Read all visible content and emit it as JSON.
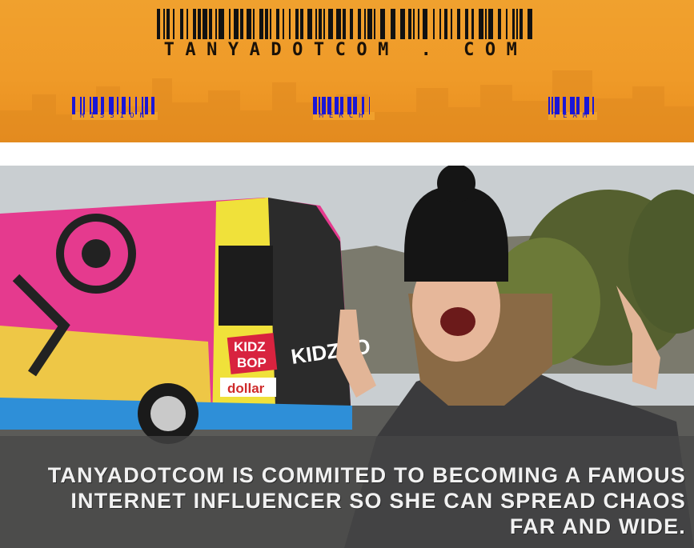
{
  "header": {
    "logo_text": "TANYADOTCOM.COM",
    "logo_display": "TANYADOTCOM . COM",
    "background_color": "#ef9a28"
  },
  "nav": {
    "items": [
      {
        "label": "MISSION"
      },
      {
        "label": "MERCH"
      },
      {
        "label": "TEAM"
      }
    ],
    "barcode_color": "#1a16d6"
  },
  "hero": {
    "bus_sign_1": "KIDZ",
    "bus_sign_2": "BOP",
    "bus_brand": "dollar",
    "bus_side_text": "KIDZBO",
    "caption": "TANYADOTCOM IS COMMITED TO BECOMING A FAMOUS INTERNET INFLUENCER SO SHE CAN SPREAD CHAOS FAR AND WIDE."
  }
}
